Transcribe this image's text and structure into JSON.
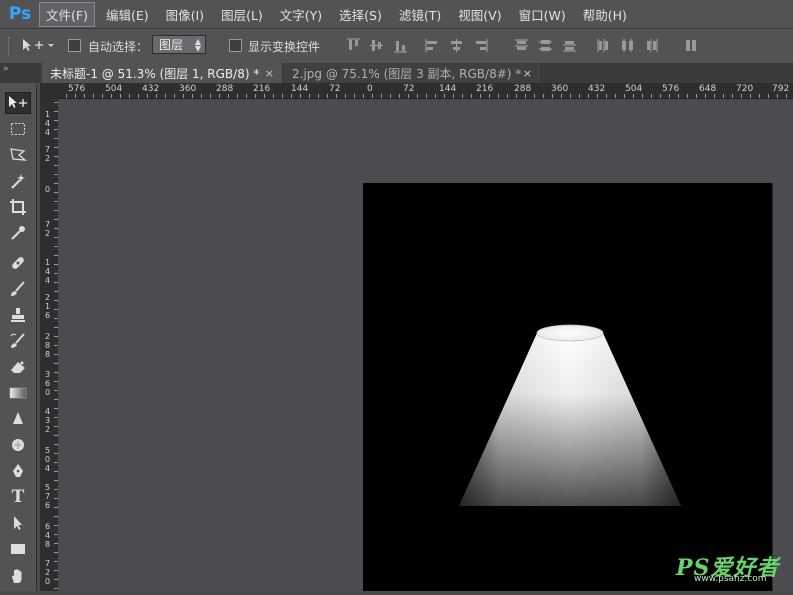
{
  "app": {
    "logo": "Ps"
  },
  "menu": [
    "文件(F)",
    "编辑(E)",
    "图像(I)",
    "图层(L)",
    "文字(Y)",
    "选择(S)",
    "滤镜(T)",
    "视图(V)",
    "窗口(W)",
    "帮助(H)"
  ],
  "options": {
    "auto_select_label": "自动选择：",
    "auto_select_value": "图层",
    "show_transform_label": "显示变换控件"
  },
  "tabs": [
    {
      "label": "未标题-1 @ 51.3% (图层 1, RGB/8) *",
      "close": "×"
    },
    {
      "label": "2.jpg @ 75.1% (图层 3 副本, RGB/8#) *",
      "close": "×"
    }
  ],
  "ruler_top": [
    "576",
    "504",
    "432",
    "360",
    "288",
    "216",
    "144",
    "72",
    "0",
    "72",
    "144",
    "216",
    "288",
    "360",
    "432",
    "504",
    "576",
    "648",
    "720",
    "792"
  ],
  "ruler_left": [
    "144",
    "72",
    "0",
    "72",
    "144",
    "216",
    "288",
    "360",
    "432",
    "504",
    "576",
    "648",
    "720"
  ],
  "tools": [
    "move-tool-icon",
    "marquee-tool-icon",
    "lasso-tool-icon",
    "magic-wand-icon",
    "crop-tool-icon",
    "eyedropper-icon",
    "healing-brush-icon",
    "brush-tool-icon",
    "clone-stamp-icon",
    "history-brush-icon",
    "eraser-icon",
    "gradient-tool-icon",
    "blur-tool-icon",
    "dodge-tool-icon",
    "pen-tool-icon",
    "type-tool-icon",
    "path-selection-icon",
    "rectangle-tool-icon",
    "hand-tool-icon"
  ],
  "watermark": {
    "main": "PS爱好者",
    "sub": "www.psahz.com"
  },
  "colors": {
    "accent": "#31a8ff",
    "watermark": "#6ad26a"
  }
}
